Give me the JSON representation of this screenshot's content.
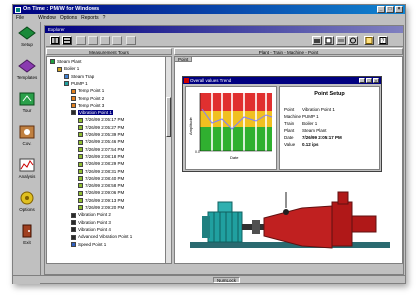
{
  "window": {
    "title": "On Time : PM/W for Windows"
  },
  "menu": [
    "File",
    "Window",
    "Options",
    "Reports",
    "?"
  ],
  "sidebar": [
    {
      "label": "Setup",
      "icon": "setup-icon"
    },
    {
      "label": "Templates",
      "icon": "templates-icon"
    },
    {
      "label": "Tour",
      "icon": "tour-icon"
    },
    {
      "label": "Cov.",
      "icon": "cov-icon"
    },
    {
      "label": "Analysis",
      "icon": "analysis-icon"
    },
    {
      "label": "Options",
      "icon": "options-icon"
    },
    {
      "label": "Exit",
      "icon": "exit-icon"
    }
  ],
  "child_window": {
    "title": "Explorer"
  },
  "headers": {
    "tours": "Measurement Tours",
    "path": "Plant - Train - Machine - Point"
  },
  "tree": [
    {
      "level": 0,
      "label": "Steam Plant",
      "icon": "plant-icon"
    },
    {
      "level": 1,
      "label": "Boiler 1",
      "icon": "boiler-icon"
    },
    {
      "level": 2,
      "label": "Steam Trap",
      "icon": "trap-icon"
    },
    {
      "level": 2,
      "label": "PUMP 1",
      "icon": "pump-icon"
    },
    {
      "level": 3,
      "label": "Temp Point 1",
      "icon": "point-icon"
    },
    {
      "level": 3,
      "label": "Temp Point 2",
      "icon": "point-icon"
    },
    {
      "level": 3,
      "label": "Temp Point 3",
      "icon": "point-icon"
    },
    {
      "level": 3,
      "label": "Vibration Point 1",
      "icon": "vibration-icon",
      "selected": true
    },
    {
      "level": 4,
      "label": "7/26/99 2:05:17 PM",
      "icon": "measure-icon"
    },
    {
      "level": 4,
      "label": "7/26/99 2:05:27 PM",
      "icon": "measure-icon"
    },
    {
      "level": 4,
      "label": "7/26/99 2:05:39 PM",
      "icon": "measure-icon"
    },
    {
      "level": 4,
      "label": "7/26/99 2:05:46 PM",
      "icon": "measure-icon"
    },
    {
      "level": 4,
      "label": "7/26/99 2:07:54 PM",
      "icon": "measure-icon"
    },
    {
      "level": 4,
      "label": "7/26/99 2:08:18 PM",
      "icon": "measure-icon"
    },
    {
      "level": 4,
      "label": "7/26/99 2:08:29 PM",
      "icon": "measure-icon"
    },
    {
      "level": 4,
      "label": "7/26/99 2:08:31 PM",
      "icon": "measure-icon"
    },
    {
      "level": 4,
      "label": "7/26/99 2:08:40 PM",
      "icon": "measure-icon"
    },
    {
      "level": 4,
      "label": "7/26/99 2:08:58 PM",
      "icon": "measure-icon"
    },
    {
      "level": 4,
      "label": "7/26/99 2:09:06 PM",
      "icon": "measure-icon"
    },
    {
      "level": 4,
      "label": "7/26/99 2:09:13 PM",
      "icon": "measure-icon"
    },
    {
      "level": 4,
      "label": "7/26/99 2:09:20 PM",
      "icon": "measure-icon"
    },
    {
      "level": 3,
      "label": "Vibration Point 2",
      "icon": "vibration-icon"
    },
    {
      "level": 3,
      "label": "Vibration Point 3",
      "icon": "vibration-icon"
    },
    {
      "level": 3,
      "label": "Vibration Point 4",
      "icon": "vibration-icon"
    },
    {
      "level": 3,
      "label": "Advanced Vibration Point 1",
      "icon": "vibration-icon"
    },
    {
      "level": 3,
      "label": "Speed Point 1",
      "icon": "speed-icon"
    }
  ],
  "point_tab": "Point",
  "trend": {
    "title": "Overall values Trend",
    "ylabel": "Amplitude",
    "xlabel": "Date",
    "y_tick": "0.0",
    "setup_title": "Point Setup",
    "setup_rows": [
      {
        "k": "Point",
        "v": "Vibration Point 1",
        "bold": false
      },
      {
        "k": "Machine",
        "v": "PUMP 1",
        "bold": false
      },
      {
        "k": "Train",
        "v": "Boiler 1",
        "bold": false
      },
      {
        "k": "Plant",
        "v": "Steam Plant",
        "bold": false
      },
      {
        "k": "Date",
        "v": "7/26/99 2:05:17 PM",
        "bold": true
      },
      {
        "k": "Value",
        "v": "0.12   ips",
        "bold": true
      }
    ]
  },
  "status": {
    "numlock": "NumLock"
  }
}
